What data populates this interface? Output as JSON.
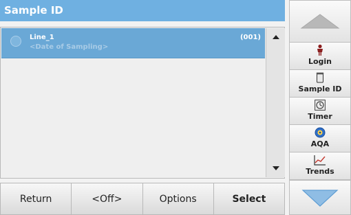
{
  "screen": {
    "title": "Sample ID"
  },
  "list": {
    "items": [
      {
        "title": "Line_1",
        "subtitle": "<Date of Sampling>",
        "number": "(001)",
        "selected": true
      }
    ]
  },
  "bottom_buttons": [
    {
      "label": "Return"
    },
    {
      "label": "<Off>"
    },
    {
      "label": "Options"
    },
    {
      "label": "Select"
    }
  ],
  "side_buttons": [
    {
      "label": "Login",
      "icon": "person-icon"
    },
    {
      "label": "Sample ID",
      "icon": "sample-container-icon"
    },
    {
      "label": "Timer",
      "icon": "timer-icon"
    },
    {
      "label": "AQA",
      "icon": "aqa-disc-icon"
    },
    {
      "label": "Trends",
      "icon": "trend-chart-icon"
    }
  ],
  "colors": {
    "title_bar": "#6fb0e1",
    "selected_row": "#6aa8d6",
    "arrow_fill": "#8fbde4",
    "arrow_up_fill": "#b8b8b8"
  }
}
